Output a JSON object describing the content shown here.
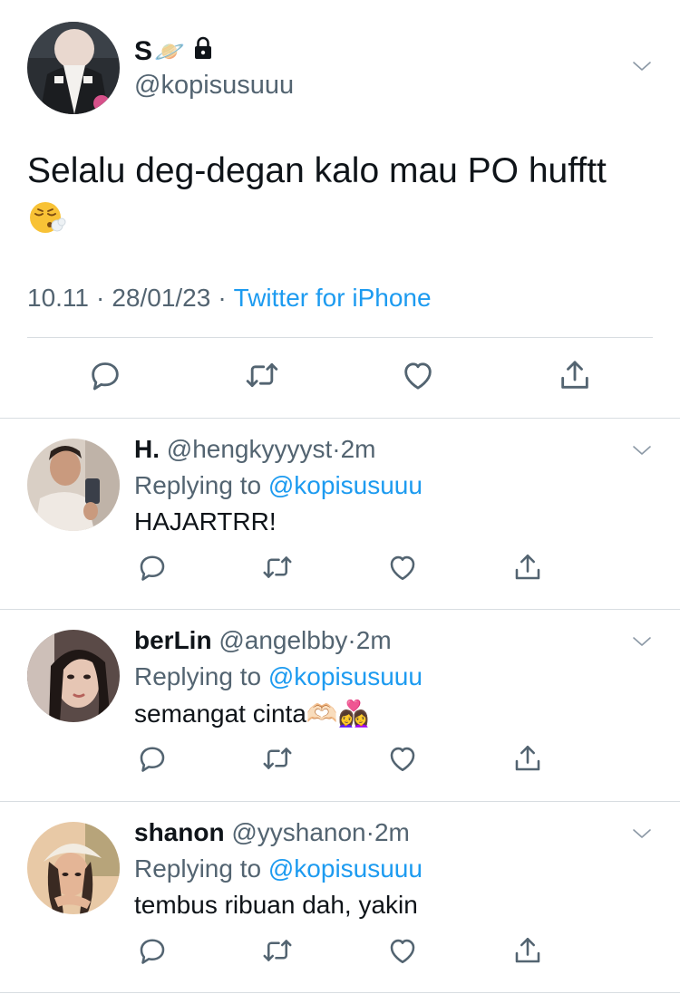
{
  "main_tweet": {
    "name": "S",
    "name_glyph": "🪐",
    "handle": "@kopisusuuu",
    "text": "Selalu deg-degan kalo mau PO hufftt",
    "emoji": "😮‍💨",
    "time": "10.11",
    "date": "28/01/23",
    "separator": "·",
    "source": "Twitter for iPhone"
  },
  "replies": [
    {
      "name": "H.",
      "handle": "@hengkyyyyst",
      "dot": "·",
      "time": "2m",
      "replying_prefix": "Replying to",
      "replying_to": "@kopisusuuu",
      "text": "HAJARTRR!"
    },
    {
      "name": "berLin",
      "handle": "@angelbby",
      "dot": "·",
      "time": "2m",
      "replying_prefix": "Replying to",
      "replying_to": "@kopisusuuu",
      "text": "semangat cinta🫶🏻👩‍❤️‍👩"
    },
    {
      "name": "shanon",
      "handle": "@yyshanon",
      "dot": "·",
      "time": "2m",
      "replying_prefix": "Replying to",
      "replying_to": "@kopisusuuu",
      "text": "tembus ribuan dah, yakin"
    }
  ],
  "icons": {
    "reply": "reply-icon",
    "retweet": "retweet-icon",
    "like": "heart-icon",
    "share": "share-icon",
    "more": "chevron-down-icon",
    "lock": "lock-icon"
  },
  "colors": {
    "link": "#1d9bf0",
    "secondary": "#536471",
    "text": "#0f1419",
    "divider": "#d8dde1"
  }
}
